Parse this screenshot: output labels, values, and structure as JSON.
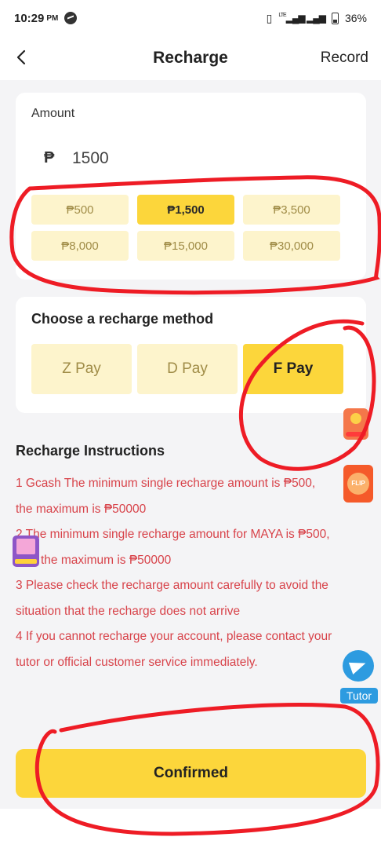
{
  "status_bar": {
    "time": "10:29",
    "ampm": "PM",
    "network": "LTE",
    "battery": "36%"
  },
  "nav": {
    "back_icon": "chevron-left-icon",
    "title": "Recharge",
    "record_label": "Record"
  },
  "amount_card": {
    "label": "Amount",
    "currency_symbol": "₱",
    "current_value": "1500",
    "options": [
      {
        "label": "₱500",
        "selected": false
      },
      {
        "label": "₱1,500",
        "selected": true
      },
      {
        "label": "₱3,500",
        "selected": false
      },
      {
        "label": "₱8,000",
        "selected": false
      },
      {
        "label": "₱15,000",
        "selected": false
      },
      {
        "label": "₱30,000",
        "selected": false
      }
    ]
  },
  "method_card": {
    "label": "Choose a recharge method",
    "methods": [
      {
        "label": "Z Pay",
        "selected": false
      },
      {
        "label": "D Pay",
        "selected": false
      },
      {
        "label": "F Pay",
        "selected": true
      }
    ]
  },
  "instructions": {
    "title": "Recharge Instructions",
    "lines": [
      "1 Gcash The minimum single recharge amount is ₱500,",
      "the maximum is ₱50000",
      "2 The minimum single recharge amount for MAYA is ₱500,",
      "the maximum is ₱50000",
      "3 Please check the recharge amount carefully to avoid the",
      "situation that the recharge does not arrive",
      "4 If you cannot recharge your account, please contact your",
      "tutor or official customer service immediately."
    ]
  },
  "floating": {
    "flip_label": "FLIP",
    "tutor_label": "Tutor"
  },
  "confirm_label": "Confirmed",
  "colors": {
    "accent": "#fcd63b",
    "accent_light": "#fdf4cc",
    "instruction_text": "#d8434a",
    "annotation": "#ee1c25"
  }
}
